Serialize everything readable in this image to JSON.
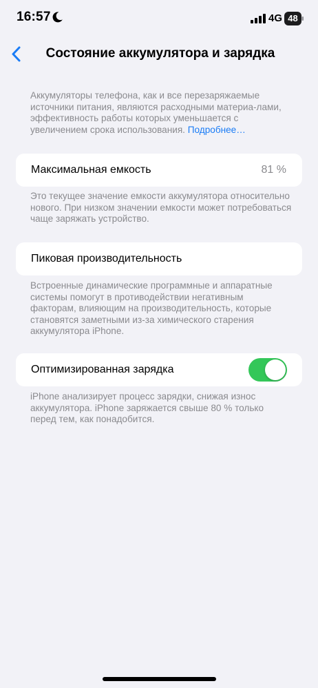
{
  "status_bar": {
    "time": "16:57",
    "network": "4G",
    "battery": "48"
  },
  "nav": {
    "title": "Состояние аккумулятора и зарядка"
  },
  "intro": {
    "text": "Аккумуляторы телефона, как и все перезаряжаемые источники питания, являются расходными материа-лами, эффективность работы которых уменьшается с увеличением срока использования.",
    "link": "Подробнее…"
  },
  "max_capacity": {
    "label": "Максимальная емкость",
    "value": "81 %",
    "footnote": "Это текущее значение емкости аккумулятора относительно нового. При низком значении емкости может потребоваться чаще заряжать устройство."
  },
  "peak_performance": {
    "label": "Пиковая производительность",
    "footnote": "Встроенные динамические программные и аппаратные системы помогут в противодействии негативным факторам, влияющим на производительность, которые становятся заметными из-за химического старения аккумулятора iPhone."
  },
  "optimized_charging": {
    "label": "Оптимизированная зарядка",
    "enabled": true,
    "footnote": "iPhone анализирует процесс зарядки, снижая износ аккумулятора. iPhone заряжается свыше 80 % только перед тем, как понадобится."
  },
  "colors": {
    "background": "#f2f2f7",
    "accent": "#1a7cf6",
    "toggle_on": "#34c759",
    "secondary_text": "#8a8a8e"
  },
  "icons": [
    "moon-icon",
    "signal-icon",
    "battery-icon",
    "chevron-left-icon"
  ]
}
